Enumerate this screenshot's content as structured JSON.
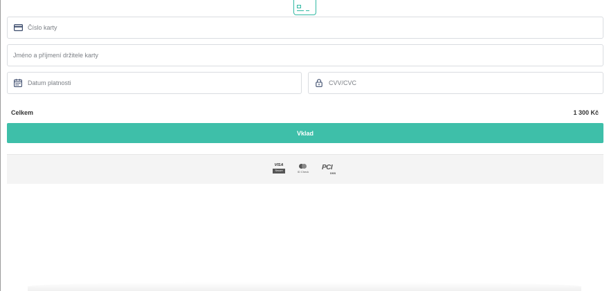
{
  "form": {
    "card_number_placeholder": "Číslo karty",
    "holder_name_placeholder": "Jméno a příjmení držitele karty",
    "expiry_placeholder": "Datum platnosti",
    "cvv_placeholder": "CVV/CVC"
  },
  "summary": {
    "total_label": "Celkem",
    "total_value": "1 300 Kč"
  },
  "actions": {
    "deposit_label": "Vklad"
  },
  "logos": {
    "visa_brand": "VISA",
    "visa_tag": "Secure",
    "mastercard_tag": "ID Check",
    "pci_brand": "PCI",
    "pci_tag": "DSS"
  },
  "colors": {
    "accent": "#3ebfa9",
    "icon": "#3a4a6b"
  },
  "icons": {
    "top": "card-chip-icon",
    "card": "credit-card-icon",
    "date": "calendar-icon",
    "cvv": "lock-icon"
  }
}
